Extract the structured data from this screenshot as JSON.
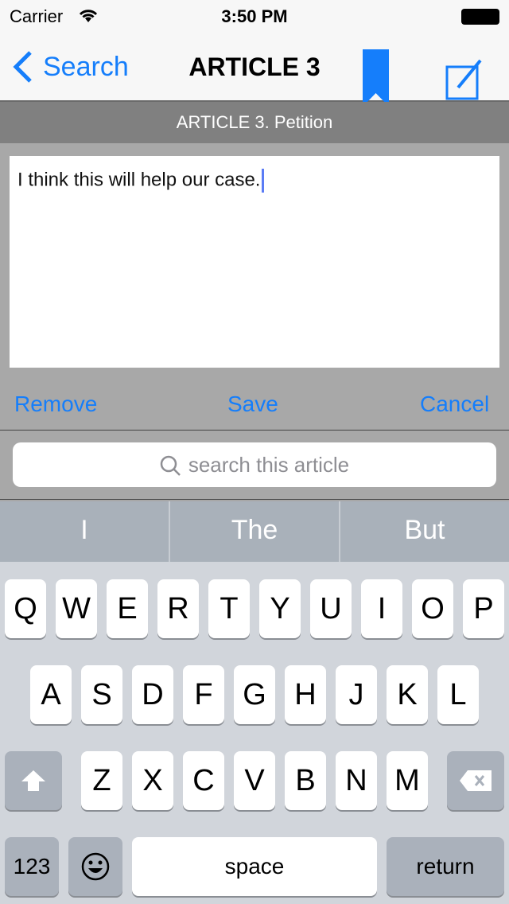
{
  "status": {
    "carrier": "Carrier",
    "time": "3:50 PM"
  },
  "nav": {
    "back_label": "Search",
    "title": "ARTICLE 3",
    "icons": [
      "chevron-left-icon",
      "bookmark-icon",
      "compose-icon"
    ]
  },
  "section_title": "ARTICLE 3. Petition",
  "note": {
    "text": "I think this will help our case."
  },
  "actions": {
    "remove": "Remove",
    "save": "Save",
    "cancel": "Cancel"
  },
  "search": {
    "placeholder": "search this article"
  },
  "suggestions": [
    "I",
    "The",
    "But"
  ],
  "keyboard": {
    "row1": [
      "Q",
      "W",
      "E",
      "R",
      "T",
      "Y",
      "U",
      "I",
      "O",
      "P"
    ],
    "row2": [
      "A",
      "S",
      "D",
      "F",
      "G",
      "H",
      "J",
      "K",
      "L"
    ],
    "row3": [
      "Z",
      "X",
      "C",
      "V",
      "B",
      "N",
      "M"
    ],
    "numbers": "123",
    "space": "space",
    "return": "return"
  },
  "colors": {
    "accent": "#157efb"
  }
}
